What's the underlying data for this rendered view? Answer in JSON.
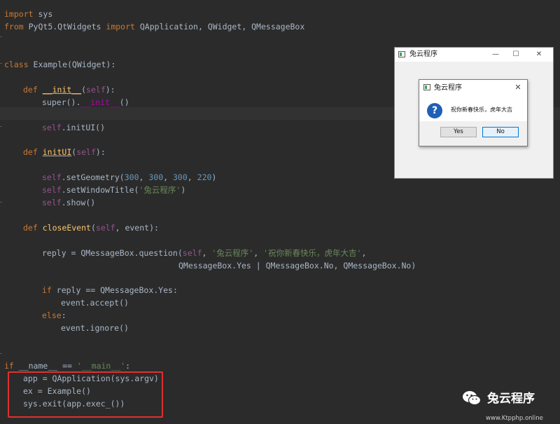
{
  "code": {
    "l1": {
      "kw": "import",
      "rest": " sys"
    },
    "l2": {
      "kw1": "from",
      "mod": " PyQt5.QtWidgets ",
      "kw2": "import",
      "rest": " QApplication, QWidget, QMessageBox"
    },
    "l3": {
      "kw": "class",
      "rest": " Example(QWidget):"
    },
    "l4": {
      "kw": "def",
      "sp": " ",
      "fn": "__init__",
      "open": "(",
      "self": "self",
      "close": "):"
    },
    "l5": {
      "pre": "super().",
      "dunder": "__init__",
      "post": "()"
    },
    "l6": {
      "self": "self",
      "rest": ".initUI()"
    },
    "l7": {
      "kw": "def",
      "sp": " ",
      "fn": "initUI",
      "open": "(",
      "self": "self",
      "close": "):"
    },
    "l8": {
      "self": "self",
      "pre": ".setGeometry(",
      "n1": "300",
      "c1": ", ",
      "n2": "300",
      "c2": ", ",
      "n3": "300",
      "c3": ", ",
      "n4": "220",
      "post": ")"
    },
    "l9": {
      "self": "self",
      "pre": ".setWindowTitle(",
      "str": "'兔云程序'",
      "post": ")"
    },
    "l10": {
      "self": "self",
      "rest": ".show()"
    },
    "l11": {
      "kw": "def",
      "sp": " ",
      "fn": "closeEvent",
      "open": "(",
      "self": "self",
      "close": ", event):"
    },
    "l12": {
      "pre": "reply = QMessageBox.question(",
      "self": "self",
      "c1": ", ",
      "s1": "'兔云程序'",
      "c2": ", ",
      "s2": "'祝你新春快乐，虎年大吉'",
      "post": ","
    },
    "l13": {
      "rest": "QMessageBox.Yes | QMessageBox.No, QMessageBox.No)"
    },
    "l14": {
      "kw": "if",
      "rest": " reply == QMessageBox.Yes:"
    },
    "l15": {
      "rest": "event.accept()"
    },
    "l16": {
      "kw": "else",
      "rest": ":"
    },
    "l17": {
      "rest": "event.ignore()"
    },
    "l18": {
      "kw": "if",
      "mid": " __name__ == ",
      "str": "'__main__'",
      "post": ":"
    },
    "l19": {
      "rest": "app = QApplication(sys.argv)"
    },
    "l20": {
      "rest": "ex = Example()"
    },
    "l21": {
      "rest": "sys.exit(app.exec_())"
    }
  },
  "window": {
    "title": "兔云程序",
    "minimize": "—",
    "maximize": "☐",
    "close": "✕"
  },
  "msgbox": {
    "title": "兔云程序",
    "close": "✕",
    "icon": "?",
    "text": "祝你新春快乐，虎年大吉",
    "yes": "Yes",
    "no": "No"
  },
  "watermark": {
    "text": "兔云程序",
    "url": "www.Ktpphp.online"
  }
}
